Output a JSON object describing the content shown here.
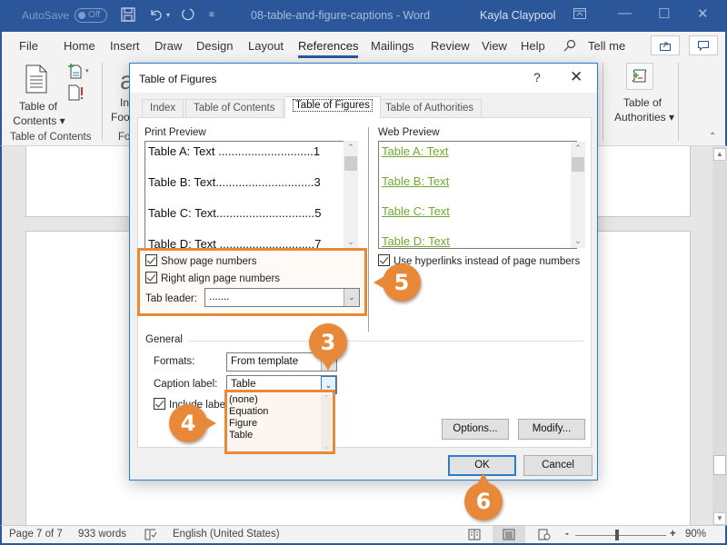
{
  "titlebar": {
    "autosave_label": "AutoSave",
    "autosave_state": "Off",
    "doc_title": "08-table-and-figure-captions - Word",
    "user": "Kayla Claypool",
    "icons": [
      "save-icon",
      "undo-icon",
      "redo-icon",
      "customize-qat-icon",
      "ribbon-display-icon",
      "minimize-icon",
      "maximize-icon",
      "close-icon"
    ]
  },
  "menu": {
    "tabs": [
      "File",
      "Home",
      "Insert",
      "Draw",
      "Design",
      "Layout",
      "References",
      "Mailings",
      "Review",
      "View",
      "Help"
    ],
    "active": "References",
    "tell_me": "Tell me"
  },
  "ribbon": {
    "toc_button": "Table of Contents",
    "toc_line1": "Table of",
    "toc_line2": "Contents",
    "toc_group": "Table of Contents",
    "footnotes_partial_1": "Ins",
    "footnotes_partial_2": "Foo",
    "footnotes_group_partial": "Fo",
    "toa_line1": "Table of",
    "toa_line2": "Authorities"
  },
  "dialog": {
    "title": "Table of Figures",
    "help": "?",
    "tabs": [
      "Index",
      "Table of Contents",
      "Table of Figures",
      "Table of Authorities"
    ],
    "active_tab": "Table of Figures",
    "print_preview": {
      "label": "Print Preview",
      "rows": [
        "Table A: Text .............................1",
        "Table B: Text..............................3",
        "Table C: Text..............................5",
        "Table D: Text .............................7"
      ]
    },
    "web_preview": {
      "label": "Web Preview",
      "rows": [
        "Table A: Text",
        "Table B: Text",
        "Table C: Text",
        "Table D: Text"
      ],
      "link_color": "#70a92d"
    },
    "show_page_numbers": {
      "label": "Show page numbers",
      "checked": true
    },
    "right_align": {
      "label": "Right align page numbers",
      "checked": true
    },
    "tab_leader": {
      "label": "Tab leader:",
      "value": "......."
    },
    "use_hyperlinks": {
      "label": "Use hyperlinks instead of page numbers",
      "checked": true
    },
    "general_label": "General",
    "formats": {
      "label": "Formats:",
      "value": "From template"
    },
    "caption_label": {
      "label": "Caption label:",
      "value": "Table",
      "options": [
        "(none)",
        "Equation",
        "Figure",
        "Table"
      ]
    },
    "include_label": {
      "label": "Include label and number",
      "visible_label": "Include labe",
      "checked": true
    },
    "options_button": "Options...",
    "modify_button": "Modify...",
    "ok_button": "OK",
    "cancel_button": "Cancel"
  },
  "callouts": [
    "3",
    "4",
    "5",
    "6"
  ],
  "callout_color": "#e8893a",
  "statusbar": {
    "page": "Page 7 of 7",
    "words": "933 words",
    "language": "English (United States)",
    "zoom": "90%",
    "zoom_minus": "-",
    "zoom_plus": "+"
  }
}
